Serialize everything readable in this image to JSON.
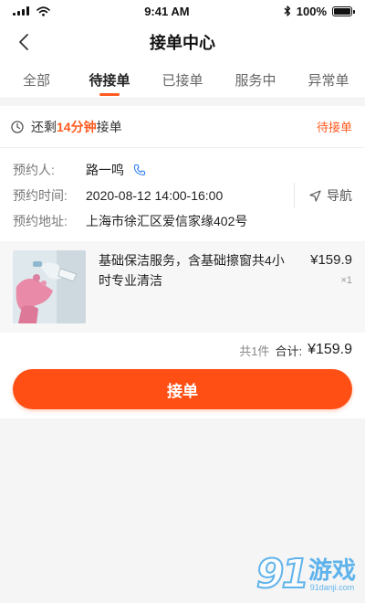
{
  "status_bar": {
    "time": "9:41 AM",
    "battery": "100%"
  },
  "nav": {
    "title": "接单中心"
  },
  "tabs": [
    {
      "label": "全部",
      "active": false
    },
    {
      "label": "待接单",
      "active": true
    },
    {
      "label": "已接单",
      "active": false
    },
    {
      "label": "服务中",
      "active": false
    },
    {
      "label": "异常单",
      "active": false
    }
  ],
  "order": {
    "remain_prefix": "还剩",
    "remain_time": "14分钟",
    "remain_suffix": "接单",
    "status": "待接单",
    "contact_label": "预约人:",
    "contact_name": "路一鸣",
    "time_label": "预约时间:",
    "time_value": "2020-08-12 14:00-16:00",
    "address_label": "预约地址:",
    "address_value": "上海市徐汇区爱信家缘402号",
    "navigate_label": "导航"
  },
  "product": {
    "description": "基础保洁服务，含基础擦窗共4小时专业清洁",
    "price": "¥159.9",
    "quantity": "×1"
  },
  "summary": {
    "count": "共1件",
    "total_label": "合计:",
    "total": "¥159.9"
  },
  "action": {
    "accept_label": "接单"
  },
  "watermark": {
    "number": "91",
    "text": "游戏",
    "site": "91danji.com"
  },
  "colors": {
    "accent": "#ff5a1f",
    "button": "#ff4f14"
  }
}
